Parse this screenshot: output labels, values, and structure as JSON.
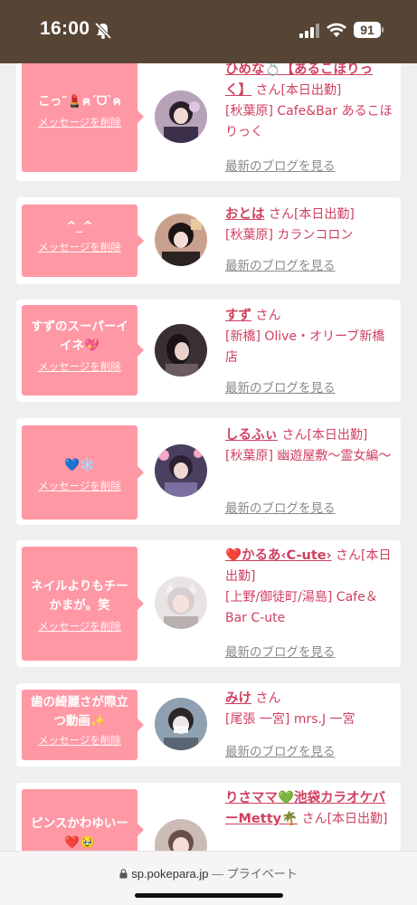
{
  "status_bar": {
    "time": "16:00",
    "battery": "91"
  },
  "cards": [
    {
      "message": "こっ″💄ฅˊᗜˋฅ",
      "delete": "メッセージを削除",
      "name": "ひめな💍【あるこほりっく】",
      "san": "さん[本日出勤]",
      "shop": "[秋葉原] Cafe&Bar あるこほりっく",
      "blog": "最新のブログを見る"
    },
    {
      "message": "^_^",
      "delete": "メッセージを削除",
      "name": "おとは",
      "san": "さん[本日出勤]",
      "shop": "[秋葉原] カランコロン",
      "blog": "最新のブログを見る"
    },
    {
      "message": "すずのスーパーイイネ💖",
      "delete": "メッセージを削除",
      "name": "すず",
      "san": "さん",
      "shop": "[新橋] Olive・オリーブ新橋店",
      "blog": "最新のブログを見る"
    },
    {
      "message": "💙❄️",
      "delete": "メッセージを削除",
      "name": "しるふぃ",
      "san": "さん[本日出勤]",
      "shop": "[秋葉原] 幽遊屋敷～霊女編～",
      "blog": "最新のブログを見る"
    },
    {
      "message": "ネイルよりもチーかまが。笑",
      "delete": "メッセージを削除",
      "name": "❤️かるあ‹C-ute›",
      "san": "さん[本日出勤]",
      "shop": "[上野/御徒町/湯島] Cafe＆Bar C-ute",
      "blog": "最新のブログを見る"
    },
    {
      "message": "歯の綺麗さが際立つ動画✨",
      "delete": "メッセージを削除",
      "name": "みけ",
      "san": "さん",
      "shop": "[尾張 一宮] mrs.J 一宮",
      "blog": "最新のブログを見る"
    },
    {
      "message": "ピンスかわゆいー❤️🥹",
      "delete": "",
      "name": "りさママ💚池袋カラオケバーMetty🌴",
      "san": "さん[本日出勤]",
      "shop": "",
      "blog": ""
    }
  ],
  "browser": {
    "domain": "sp.pokepara.jp",
    "separator": "—",
    "mode": "プライベート"
  }
}
